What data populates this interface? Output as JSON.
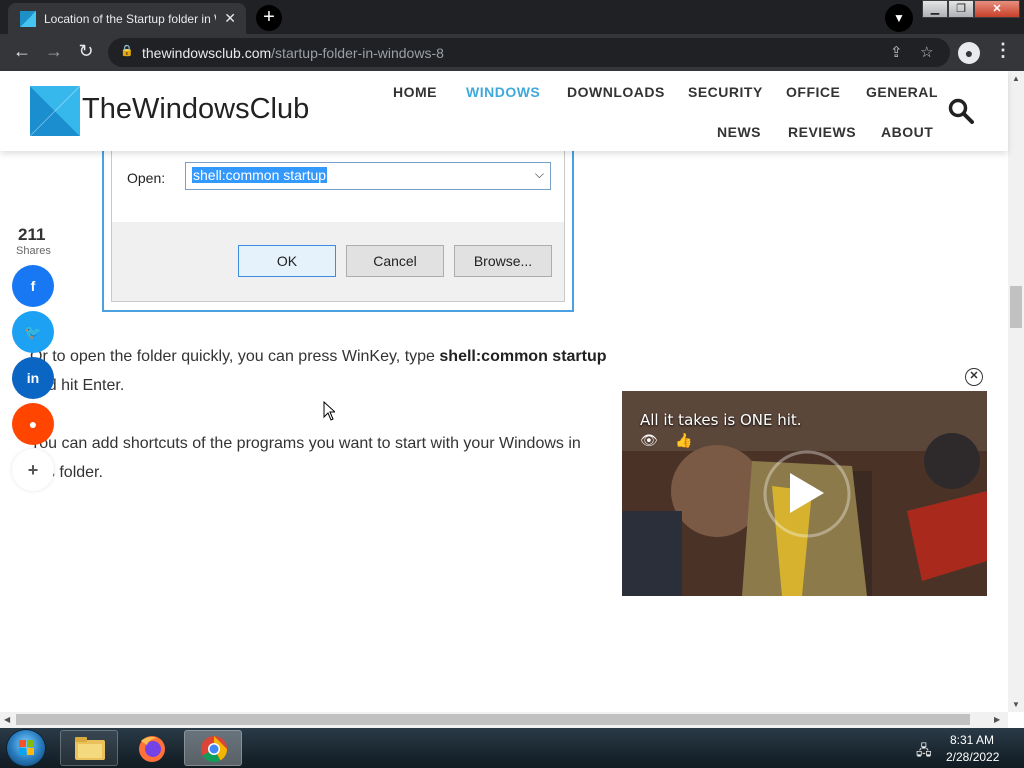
{
  "browser": {
    "tab_title": "Location of the Startup folder in W",
    "url_domain": "thewindowsclub.com",
    "url_path": "/startup-folder-in-windows-8",
    "accent": "#3fa9dc"
  },
  "site": {
    "logo_text": "TheWindowsClub",
    "nav": {
      "home": "HOME",
      "windows": "WINDOWS",
      "downloads": "DOWNLOADS",
      "security": "SECURITY",
      "office": "OFFICE",
      "general": "GENERAL",
      "news": "NEWS",
      "reviews": "REVIEWS",
      "about": "ABOUT"
    }
  },
  "dialog": {
    "open_label": "Open:",
    "open_value": "shell:common startup",
    "ok": "OK",
    "cancel": "Cancel",
    "browse": "Browse..."
  },
  "article": {
    "p1_a": "Or to open the folder quickly, you can press WinKey, type ",
    "p1_b": "shell:common startup",
    "p1_c": "and hit Enter.",
    "p2_a": "You can add shortcuts of the programs you want to start with your Windows in",
    "p2_b": "this folder."
  },
  "share": {
    "count": "211",
    "label": "Shares",
    "facebook_color": "#1877f2",
    "twitter_color": "#1da1f2",
    "linkedin_color": "#0a66c2",
    "reddit_color": "#ff4500"
  },
  "video": {
    "title": "All it takes is ONE hit."
  },
  "taskbar": {
    "time": "8:31 AM",
    "date": "2/28/2022"
  }
}
